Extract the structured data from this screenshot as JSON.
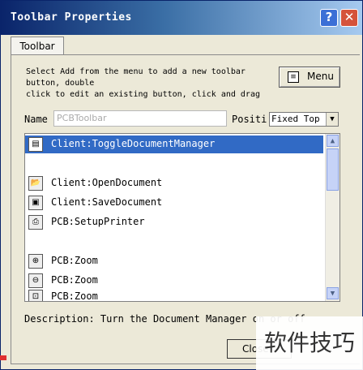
{
  "window": {
    "title": "Toolbar Properties",
    "help_label": "?",
    "close_label": "✕"
  },
  "tabs": [
    {
      "label": "Toolbar"
    }
  ],
  "instructions": {
    "line1": "Select Add from the menu to add a new toolbar",
    "line2": "button, double",
    "line3": "click to edit an existing button, click and drag"
  },
  "menu_button": {
    "label": "Menu",
    "icon": "menu-icon"
  },
  "name_field": {
    "label": "Name",
    "value": "PCBToolbar"
  },
  "position_field": {
    "label": "Positi",
    "value": "Fixed Top"
  },
  "toolbar_items": [
    {
      "icon": "document-manager-icon",
      "label": "Client:ToggleDocumentManager",
      "selected": true
    },
    {
      "icon": "",
      "label": ""
    },
    {
      "icon": "open-folder-icon",
      "label": "Client:OpenDocument"
    },
    {
      "icon": "save-icon",
      "label": "Client:SaveDocument"
    },
    {
      "icon": "printer-icon",
      "label": "PCB:SetupPrinter"
    },
    {
      "icon": "",
      "label": ""
    },
    {
      "icon": "zoom-in-icon",
      "label": "PCB:Zoom"
    },
    {
      "icon": "zoom-out-icon",
      "label": "PCB:Zoom"
    },
    {
      "icon": "zoom-area-icon",
      "label": "PCB:Zoom"
    }
  ],
  "description": {
    "text": "Description: Turn the Document Manager on or off"
  },
  "close_button": {
    "label": "Close"
  },
  "watermark": {
    "text": "软件技巧"
  },
  "colors": {
    "selection": "#316ac5",
    "titlebar": "#0a246a"
  }
}
